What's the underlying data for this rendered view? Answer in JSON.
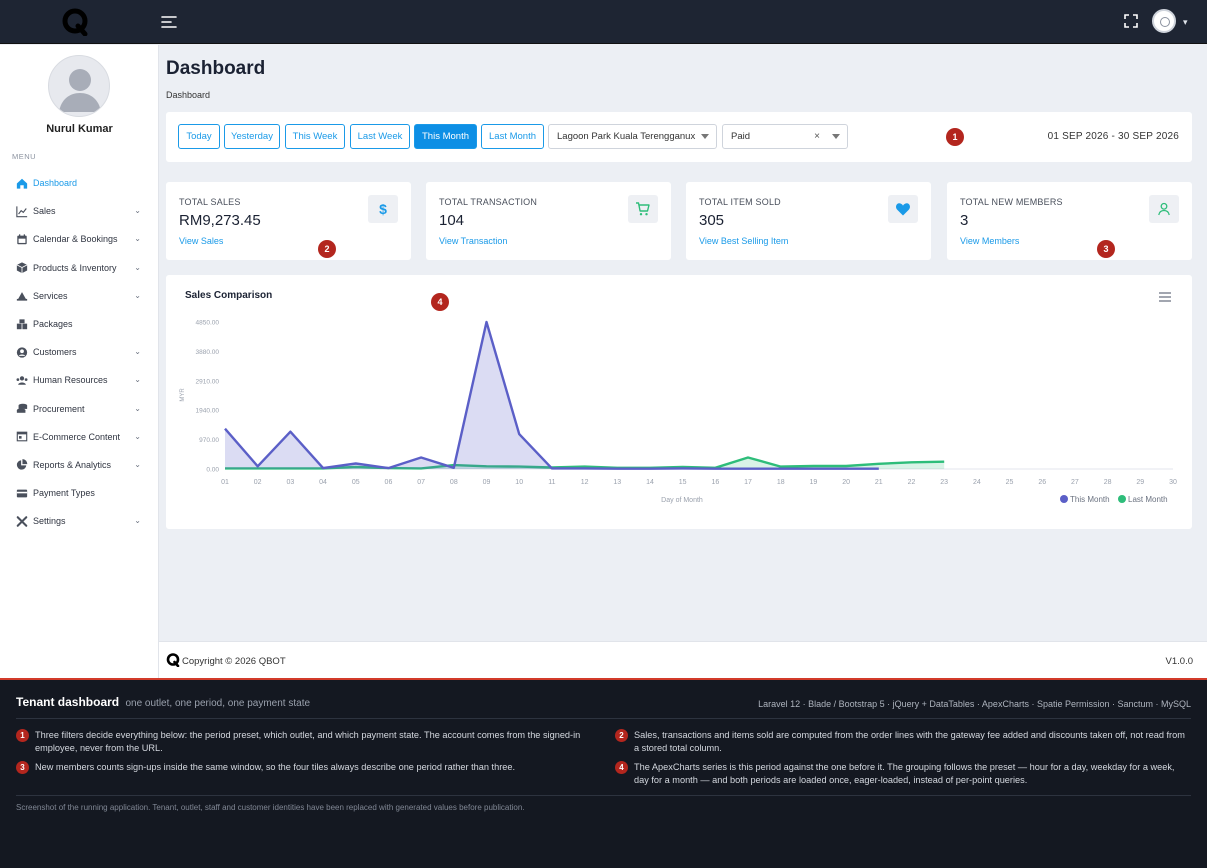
{
  "user": {
    "name": "Nurul Kumar"
  },
  "sidebar": {
    "menu_label": "MENU",
    "items": [
      {
        "label": "Dashboard",
        "icon": "home-icon",
        "active": true,
        "expandable": false
      },
      {
        "label": "Sales",
        "icon": "chart-line-icon",
        "expandable": true
      },
      {
        "label": "Calendar & Bookings",
        "icon": "calendar-icon",
        "expandable": true
      },
      {
        "label": "Products & Inventory",
        "icon": "box-icon",
        "expandable": true
      },
      {
        "label": "Services",
        "icon": "cloud-icon",
        "expandable": true
      },
      {
        "label": "Packages",
        "icon": "boxes-icon",
        "expandable": false
      },
      {
        "label": "Customers",
        "icon": "user-circle-icon",
        "expandable": true
      },
      {
        "label": "Human Resources",
        "icon": "users-icon",
        "expandable": true
      },
      {
        "label": "Procurement",
        "icon": "coins-icon",
        "expandable": true
      },
      {
        "label": "E-Commerce Content",
        "icon": "window-icon",
        "expandable": true
      },
      {
        "label": "Reports & Analytics",
        "icon": "pie-chart-icon",
        "expandable": true
      },
      {
        "label": "Payment Types",
        "icon": "credit-card-icon",
        "expandable": false
      },
      {
        "label": "Settings",
        "icon": "tools-icon",
        "expandable": true
      }
    ]
  },
  "page": {
    "title": "Dashboard",
    "breadcrumb": "Dashboard"
  },
  "filters": {
    "presets": [
      "Today",
      "Yesterday",
      "This Week",
      "Last Week",
      "This Month",
      "Last Month"
    ],
    "active_preset": "This Month",
    "outlet": "Lagoon Park Kuala Terengganux",
    "payment_state": "Paid",
    "clear_glyph": "×",
    "date_range": "01 SEP 2026 - 30 SEP 2026"
  },
  "cards": [
    {
      "title": "TOTAL SALES",
      "value": "RM9,273.45",
      "link": "View Sales",
      "icon": "dollar-icon",
      "icon_color": "#1a9ae8"
    },
    {
      "title": "TOTAL TRANSACTION",
      "value": "104",
      "link": "View Transaction",
      "icon": "cart-icon",
      "icon_color": "#2ebd7a"
    },
    {
      "title": "TOTAL ITEM SOLD",
      "value": "305",
      "link": "View Best Selling Item",
      "icon": "heart-icon",
      "icon_color": "#1a9ae8"
    },
    {
      "title": "TOTAL NEW MEMBERS",
      "value": "3",
      "link": "View Members",
      "icon": "user-icon",
      "icon_color": "#2ebd7a"
    }
  ],
  "badges": [
    "1",
    "2",
    "3",
    "4"
  ],
  "chart_data": {
    "type": "area",
    "title": "Sales Comparison",
    "xlabel": "Day of Month",
    "ylabel": "MYR",
    "categories": [
      "01",
      "02",
      "03",
      "04",
      "05",
      "06",
      "07",
      "08",
      "09",
      "10",
      "11",
      "12",
      "13",
      "14",
      "15",
      "16",
      "17",
      "18",
      "19",
      "20",
      "21",
      "22",
      "23",
      "24",
      "25",
      "26",
      "27",
      "28",
      "29",
      "30"
    ],
    "y_ticks": [
      "0.00",
      "970.00",
      "1940.00",
      "2910.00",
      "3880.00",
      "4850.00"
    ],
    "ylim": [
      0,
      4850
    ],
    "grid": false,
    "legend": "bottom-right",
    "series": [
      {
        "name": "This Month",
        "color": "#5b5fc7",
        "values": [
          1330,
          90,
          1230,
          30,
          180,
          30,
          380,
          40,
          4850,
          1150,
          20,
          20,
          10,
          10,
          20,
          10,
          10,
          10,
          10,
          10,
          10
        ]
      },
      {
        "name": "Last Month",
        "color": "#2ebd7a",
        "values": [
          20,
          20,
          20,
          20,
          70,
          30,
          20,
          130,
          90,
          80,
          50,
          80,
          40,
          40,
          70,
          40,
          380,
          80,
          100,
          100,
          170,
          220,
          240
        ]
      }
    ]
  },
  "footer": {
    "copyright": "Copyright © 2026 QBOT",
    "version": "V1.0.0"
  },
  "notes_panel": {
    "title": "Tenant dashboard",
    "subtitle": "one outlet, one period, one payment state",
    "stack": "Laravel 12 · Blade / Bootstrap 5 · jQuery + DataTables · ApexCharts · Spatie Permission · Sanctum · MySQL",
    "notes": [
      {
        "num": "1",
        "text": "Three filters decide everything below: the period preset, which outlet, and which payment state. The account comes from the signed-in employee, never from the URL."
      },
      {
        "num": "2",
        "text": "Sales, transactions and items sold are computed from the order lines with the gateway fee added and discounts taken off, not read from a stored total column."
      },
      {
        "num": "3",
        "text": "New members counts sign-ups inside the same window, so the four tiles always describe one period rather than three."
      },
      {
        "num": "4",
        "text": "The ApexCharts series is this period against the one before it. The grouping follows the preset — hour for a day, weekday for a week, day for a month — and both periods are loaded once, eager-loaded, instead of per-point queries."
      }
    ],
    "disclaimer": "Screenshot of the running application. Tenant, outlet, staff and customer identities have been replaced with generated values before publication."
  }
}
